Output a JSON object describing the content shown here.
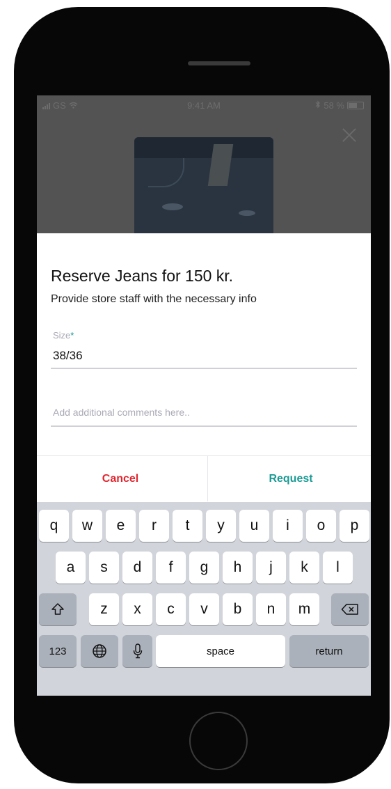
{
  "status_bar": {
    "carrier": "GS",
    "time": "9:41 AM",
    "battery": "58 %"
  },
  "dialog": {
    "title": "Reserve Jeans for 150 kr.",
    "subtitle": "Provide store staff with the necessary info",
    "size_field": {
      "label": "Size",
      "required_mark": "*",
      "value": "38/36"
    },
    "comments_field": {
      "placeholder": "Add additional comments here.."
    },
    "cancel_label": "Cancel",
    "request_label": "Request"
  },
  "keyboard": {
    "row1": [
      "q",
      "w",
      "e",
      "r",
      "t",
      "y",
      "u",
      "i",
      "o",
      "p"
    ],
    "row2": [
      "a",
      "s",
      "d",
      "f",
      "g",
      "h",
      "j",
      "k",
      "l"
    ],
    "row3": [
      "z",
      "x",
      "c",
      "v",
      "b",
      "n",
      "m"
    ],
    "numbers_label": "123",
    "space_label": "space",
    "return_label": "return"
  },
  "colors": {
    "accent": "#1b9a94",
    "cancel": "#e0262f",
    "keyboard_bg": "#d1d4da"
  }
}
